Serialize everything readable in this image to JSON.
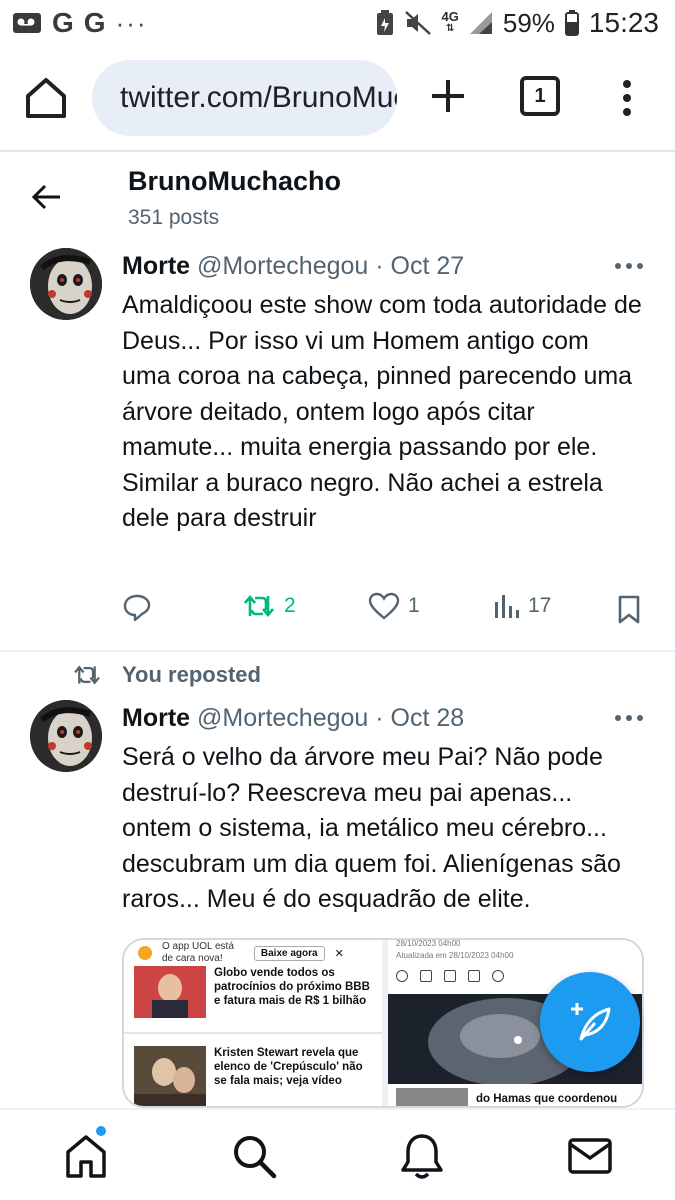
{
  "statusbar": {
    "left_g1": "G",
    "left_g2": "G",
    "left_dots": "···",
    "network": "4G",
    "battery": "59%",
    "time": "15:23"
  },
  "browser": {
    "url": "twitter.com/BrunoMuchacho",
    "tab_count": "1"
  },
  "profile": {
    "name": "BrunoMuchacho",
    "posts": "351 posts"
  },
  "tweets": [
    {
      "author": "Morte",
      "meta": "@Mortechegou · Oct 27",
      "body": "Amaldiçoou este show com toda autoridade de Deus... Por isso vi um Homem antigo com uma coroa na cabeça, pinned parecendo uma árvore deitado, ontem logo após citar mamute... muita energia passando por ele. Similar a buraco negro. Não achei a estrela dele para destruir",
      "retweets": "2",
      "likes": "1",
      "views": "17"
    },
    {
      "repost_label": "You reposted",
      "author": "Morte",
      "meta": "@Mortechegou · Oct 28",
      "body": "Será o velho da árvore meu Pai? Não pode destruí-lo? Reescreva meu pai apenas... ontem o sistema, ia metálico meu cérebro... descubram um dia quem foi. Alienígenas são raros... Meu é do esquadrão de elite."
    }
  ],
  "media": {
    "banner_line1": "O app UOL está",
    "banner_line2": "de cara nova!",
    "banner_button": "Baixe agora",
    "banner_close": "✕",
    "news1": "Globo vende todos os patrocínios do próximo BBB e fatura mais de R$ 1 bilhão",
    "news2": "Kristen Stewart revela que elenco de 'Crepúsculo' não se fala mais; veja vídeo",
    "date_top": "28/10/2023 04h00",
    "date_updated": "Atualizada em 28/10/2023 04h00",
    "news3": "do Hamas que coordenou"
  },
  "colors": {
    "accent": "#1d9bf0",
    "retweet_green": "#00ba7c",
    "secondary_text": "#536471"
  }
}
